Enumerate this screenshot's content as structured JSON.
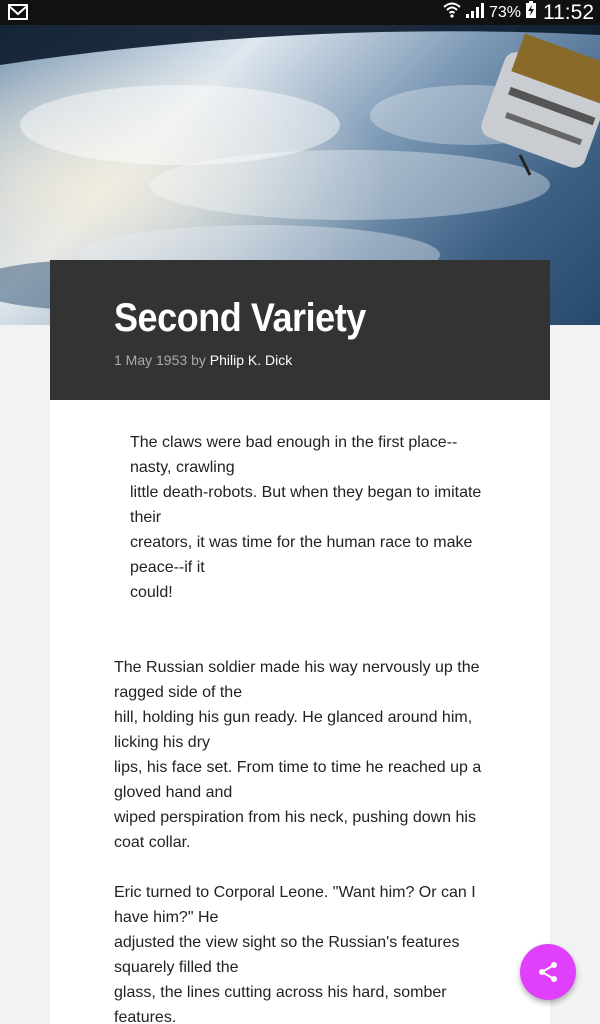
{
  "status_bar": {
    "battery_text": "73%",
    "time": "11:52",
    "icons": [
      "gmail-icon",
      "wifi-icon",
      "signal-icon",
      "battery-icon"
    ]
  },
  "article": {
    "title": "Second Variety",
    "date": "1 May 1953",
    "by_label": "by",
    "author": "Philip K. Dick",
    "epigraph": [
      "The claws were bad enough in the first place--nasty, crawling",
      "little death-robots. But when they began to imitate their",
      "creators, it was time for the human race to make peace--if it",
      "could!"
    ],
    "paragraph1": [
      "The Russian soldier made his way nervously up the ragged side of the",
      "hill, holding his gun ready. He glanced around him, licking his dry",
      "lips, his face set. From time to time he reached up a gloved hand and",
      "wiped perspiration from his neck, pushing down his coat collar."
    ],
    "paragraph2": [
      "Eric turned to Corporal Leone. \"Want him? Or can I have him?\" He",
      "adjusted the view sight so the Russian's features squarely filled the",
      "glass, the lines cutting across his hard, somber features."
    ]
  },
  "fab": {
    "icon": "share-icon"
  },
  "colors": {
    "title_card": "#333333",
    "fab": "#e040fb",
    "background": "#f2f2f2"
  }
}
